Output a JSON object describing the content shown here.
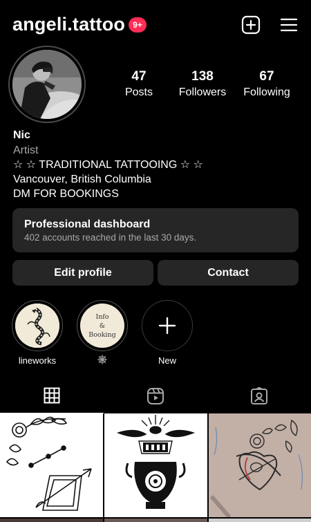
{
  "header": {
    "username": "angeli.tattoo",
    "notification_badge": "9+"
  },
  "profile": {
    "stats": {
      "posts_count": "47",
      "posts_label": "Posts",
      "followers_count": "138",
      "followers_label": "Followers",
      "following_count": "67",
      "following_label": "Following"
    },
    "name": "Nic",
    "category": "Artist",
    "bio_lines": [
      "☆ ☆ TRADITIONAL TATTOOING ☆ ☆",
      "Vancouver, British Columbia",
      "DM FOR BOOKINGS"
    ]
  },
  "dashboard": {
    "title": "Professional dashboard",
    "subtitle": "402 accounts reached in the last 30 days."
  },
  "buttons": {
    "edit_profile": "Edit profile",
    "contact": "Contact"
  },
  "highlights": [
    {
      "label": "lineworks"
    },
    {
      "label": "",
      "icon": "spiderweb-icon",
      "cover_lines": [
        "Info",
        "&",
        "Booking"
      ]
    },
    {
      "label": "New",
      "icon": "plus-icon"
    }
  ],
  "tabs": [
    {
      "icon": "grid-icon",
      "active": true
    },
    {
      "icon": "reels-icon",
      "active": false
    },
    {
      "icon": "tagged-icon",
      "active": false
    }
  ],
  "colors": {
    "background": "#000000",
    "surface": "#262626",
    "secondary_text": "#a8a8a8",
    "badge": "#ff2d55"
  }
}
